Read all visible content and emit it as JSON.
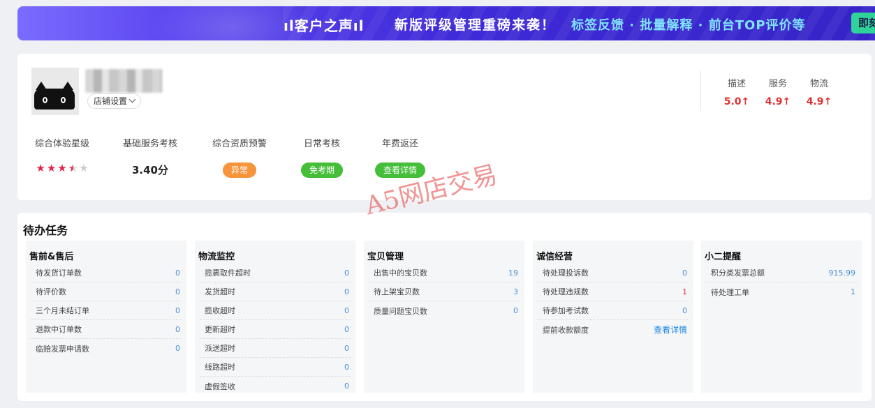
{
  "banner": {
    "brand": "ıl客户之声ıl",
    "headline": "新版评级管理重磅来袭！",
    "features": "标签反馈 · 批量解释 · 前台TOP评价等",
    "cta": "即刻体"
  },
  "shop": {
    "settings_label": "店铺设置",
    "dsr": [
      {
        "label": "描述",
        "value": "5.0↑"
      },
      {
        "label": "服务",
        "value": "4.9↑"
      },
      {
        "label": "物流",
        "value": "4.9↑"
      }
    ],
    "metrics": {
      "experience": {
        "label": "综合体验星级",
        "stars": 3.5,
        "max_stars": 5
      },
      "basic_service": {
        "label": "基础服务考核",
        "value": "3.40分"
      },
      "qualification": {
        "label": "综合资质预警",
        "status": "异常"
      },
      "daily": {
        "label": "日常考核",
        "status": "免考期"
      },
      "annual_fee": {
        "label": "年费返还",
        "status": "查看详情"
      }
    }
  },
  "watermark": "A5网店交易",
  "tasks": {
    "title": "待办任务",
    "panels": [
      {
        "title": "售前&售后",
        "rows": [
          {
            "label": "待发货订单数",
            "value": "0"
          },
          {
            "label": "待评价数",
            "value": "0"
          },
          {
            "label": "三个月未结订单",
            "value": "0"
          },
          {
            "label": "退款中订单数",
            "value": "0"
          },
          {
            "label": "临赔发票申请数",
            "value": "0"
          }
        ]
      },
      {
        "title": "物流监控",
        "rows": [
          {
            "label": "揽裹取件超时",
            "value": "0"
          },
          {
            "label": "发货超时",
            "value": "0"
          },
          {
            "label": "揽收超时",
            "value": "0"
          },
          {
            "label": "更新超时",
            "value": "0"
          },
          {
            "label": "派送超时",
            "value": "0"
          },
          {
            "label": "线路超时",
            "value": "0"
          },
          {
            "label": "虚假签收",
            "value": "0"
          }
        ]
      },
      {
        "title": "宝贝管理",
        "rows": [
          {
            "label": "出售中的宝贝数",
            "value": "19"
          },
          {
            "label": "待上架宝贝数",
            "value": "3"
          },
          {
            "label": "质量问题宝贝数",
            "value": "0"
          }
        ]
      },
      {
        "title": "诚信经营",
        "rows": [
          {
            "label": "待处理投诉数",
            "value": "0"
          },
          {
            "label": "待处理违规数",
            "value": "1"
          },
          {
            "label": "待参加考试数",
            "value": "0"
          },
          {
            "label": "提前收款额度",
            "value": "查看详情"
          }
        ]
      },
      {
        "title": "小二提醒",
        "rows": [
          {
            "label": "积分类发票总额",
            "value": "915.99"
          },
          {
            "label": "待处理工单",
            "value": "1"
          }
        ]
      }
    ]
  },
  "colors": {
    "accent_red": "#e03131",
    "value_blue": "#4a8fd6",
    "pill_orange": "#f7953d",
    "pill_green": "#45be3a"
  }
}
